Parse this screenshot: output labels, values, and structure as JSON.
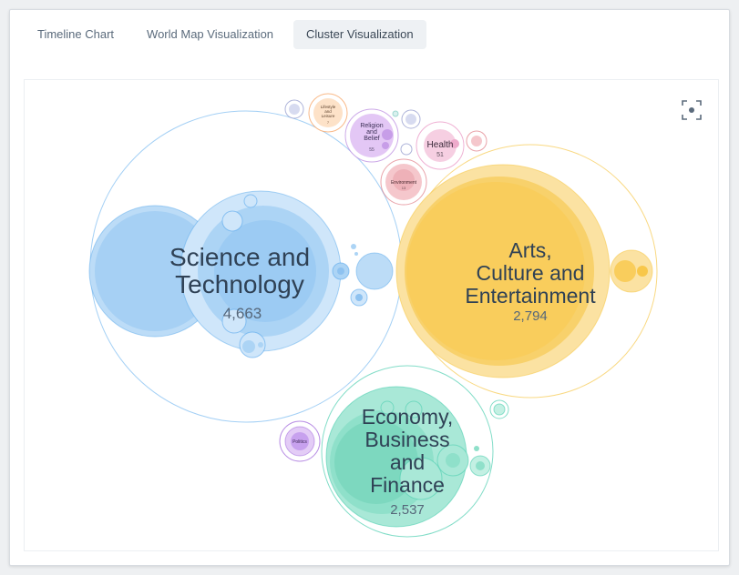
{
  "tabs": [
    {
      "label": "Timeline Chart",
      "active": false
    },
    {
      "label": "World Map Visualization",
      "active": false
    },
    {
      "label": "Cluster Visualization",
      "active": true
    }
  ],
  "viz": {
    "focus_icon": "focus-frame-icon",
    "clusters": [
      {
        "name": "science",
        "lines": [
          "Science and",
          "Technology"
        ],
        "count": "4,663",
        "color": "#5aa9ec"
      },
      {
        "name": "arts",
        "lines": [
          "Arts,",
          "Culture and",
          "Entertainment"
        ],
        "count": "2,794",
        "color": "#f7c94e"
      },
      {
        "name": "economy",
        "lines": [
          "Economy,",
          "Business",
          "and",
          "Finance"
        ],
        "count": "2,537",
        "color": "#4fcfb0"
      },
      {
        "name": "religion",
        "lines": [
          "Religion",
          "and",
          "Belief"
        ],
        "count": "55",
        "color": "#b784de"
      },
      {
        "name": "health",
        "lines": [
          "Health"
        ],
        "count": "51",
        "color": "#e88fc0"
      },
      {
        "name": "lifestyle",
        "lines": [
          "Lifestyle",
          "and",
          "Leisure"
        ],
        "count": "7",
        "color": "#f7a86a"
      },
      {
        "name": "environment",
        "lines": [
          "Environment"
        ],
        "count": "13",
        "color": "#e07a84"
      },
      {
        "name": "politics",
        "lines": [
          "Politics"
        ],
        "count": "",
        "color": "#9b5fd9"
      }
    ]
  }
}
